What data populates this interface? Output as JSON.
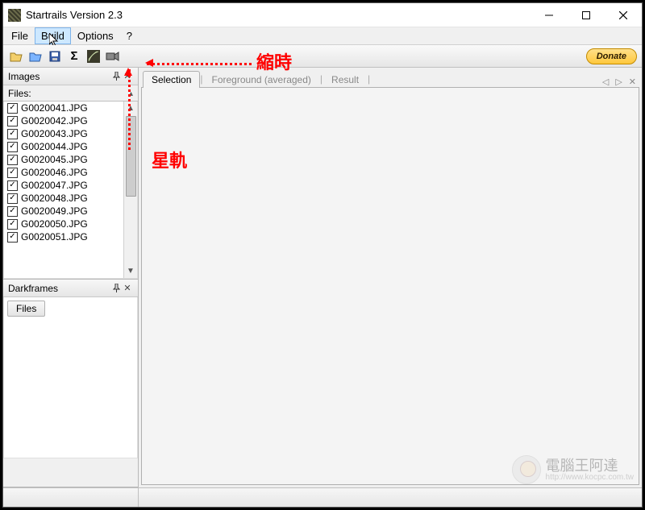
{
  "window": {
    "title": "Startrails Version 2.3"
  },
  "menu": {
    "file": "File",
    "build": "Build",
    "options": "Options",
    "help": "?"
  },
  "toolbar": {
    "open_icon": "open-folder-icon",
    "open2_icon": "open-folder-blue-icon",
    "save_icon": "save-icon",
    "sigma_icon": "sigma-icon",
    "startrails_icon": "startrails-icon",
    "video_icon": "video-icon",
    "donate_label": "Donate"
  },
  "panels": {
    "images": {
      "title": "Images",
      "files_label": "Files:",
      "files": [
        "G0020041.JPG",
        "G0020042.JPG",
        "G0020043.JPG",
        "G0020044.JPG",
        "G0020045.JPG",
        "G0020046.JPG",
        "G0020047.JPG",
        "G0020048.JPG",
        "G0020049.JPG",
        "G0020050.JPG",
        "G0020051.JPG"
      ]
    },
    "darkframes": {
      "title": "Darkframes",
      "button": "Files"
    }
  },
  "tabs": {
    "selection": "Selection",
    "foreground": "Foreground (averaged)",
    "result": "Result"
  },
  "annotations": {
    "timelapse": "縮時",
    "startrails": "星軌"
  },
  "watermark": {
    "text": "電腦王阿達",
    "url": "http://www.kocpc.com.tw"
  }
}
